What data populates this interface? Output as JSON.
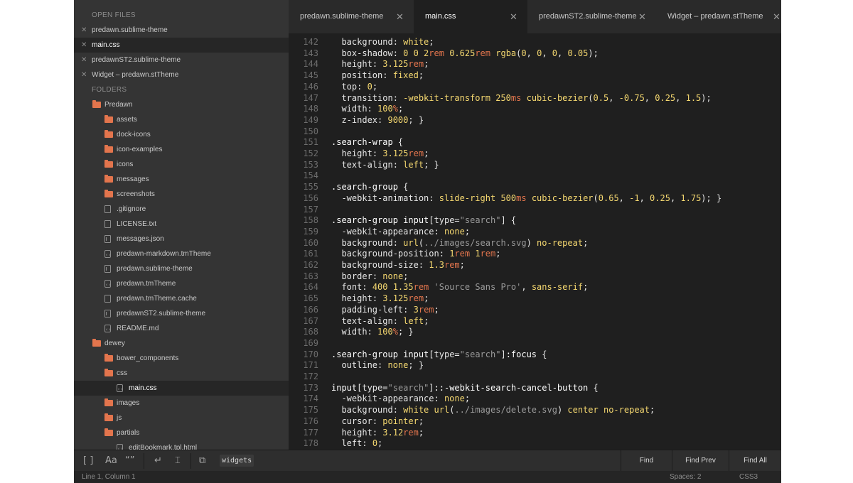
{
  "sidebar": {
    "open_files_title": "OPEN FILES",
    "open_files": [
      {
        "name": "predawn.sublime-theme",
        "active": false
      },
      {
        "name": "main.css",
        "active": true
      },
      {
        "name": "predawnST2.sublime-theme",
        "active": false
      },
      {
        "name": "Widget – predawn.stTheme",
        "active": false
      }
    ],
    "folders_title": "FOLDERS",
    "tree": [
      {
        "name": "Predawn",
        "kind": "folder",
        "depth": 0
      },
      {
        "name": "assets",
        "kind": "folder",
        "depth": 1
      },
      {
        "name": "dock-icons",
        "kind": "folder",
        "depth": 1
      },
      {
        "name": "icon-examples",
        "kind": "folder",
        "depth": 1
      },
      {
        "name": "icons",
        "kind": "folder",
        "depth": 1
      },
      {
        "name": "messages",
        "kind": "folder",
        "depth": 1
      },
      {
        "name": "screenshots",
        "kind": "folder",
        "depth": 1
      },
      {
        "name": ".gitignore",
        "kind": "file",
        "depth": 1
      },
      {
        "name": "LICENSE.txt",
        "kind": "file",
        "depth": 1
      },
      {
        "name": "messages.json",
        "kind": "json",
        "depth": 1
      },
      {
        "name": "predawn-markdown.tmTheme",
        "kind": "code",
        "depth": 1
      },
      {
        "name": "predawn.sublime-theme",
        "kind": "json",
        "depth": 1
      },
      {
        "name": "predawn.tmTheme",
        "kind": "code",
        "depth": 1
      },
      {
        "name": "predawn.tmTheme.cache",
        "kind": "file",
        "depth": 1
      },
      {
        "name": "predawnST2.sublime-theme",
        "kind": "json",
        "depth": 1
      },
      {
        "name": "README.md",
        "kind": "code",
        "depth": 1
      },
      {
        "name": "dewey",
        "kind": "folder",
        "depth": 0
      },
      {
        "name": "bower_components",
        "kind": "folder",
        "depth": 1
      },
      {
        "name": "css",
        "kind": "folder",
        "depth": 1
      },
      {
        "name": "main.css",
        "kind": "code",
        "depth": 2,
        "selected": true
      },
      {
        "name": "images",
        "kind": "folder",
        "depth": 1
      },
      {
        "name": "js",
        "kind": "folder",
        "depth": 1
      },
      {
        "name": "partials",
        "kind": "folder",
        "depth": 1
      },
      {
        "name": "editBookmark.tpl.html",
        "kind": "code",
        "depth": 2
      }
    ]
  },
  "tabs": [
    {
      "label": "predawn.sublime-theme",
      "active": false
    },
    {
      "label": "main.css",
      "active": true
    },
    {
      "label": "predawnST2.sublime-theme",
      "active": false
    },
    {
      "label": "Widget – predawn.stTheme",
      "active": false
    }
  ],
  "editor": {
    "lines": [
      {
        "n": "142",
        "t": "  <span class='t-p'>background</span>: <span class='t-v'>white</span>;"
      },
      {
        "n": "143",
        "t": "  <span class='t-p'>box-shadow</span>: <span class='t-n'>0 0 2</span><span class='t-u'>rem</span> <span class='t-n'>0.625</span><span class='t-u'>rem</span> <span class='t-v'>rgba</span>(<span class='t-n'>0</span>, <span class='t-n'>0</span>, <span class='t-n'>0</span>, <span class='t-n'>0.05</span>);"
      },
      {
        "n": "144",
        "t": "  <span class='t-p'>height</span>: <span class='t-n'>3.125</span><span class='t-u'>rem</span>;"
      },
      {
        "n": "145",
        "t": "  <span class='t-p'>position</span>: <span class='t-v'>fixed</span>;"
      },
      {
        "n": "146",
        "t": "  <span class='t-p'>top</span>: <span class='t-n'>0</span>;"
      },
      {
        "n": "147",
        "t": "  <span class='t-p'>transition</span>: <span class='t-v'>-webkit-transform</span> <span class='t-n'>250</span><span class='t-u'>ms</span> <span class='t-v'>cubic-bezier</span>(<span class='t-n'>0.5</span>, <span class='t-n'>-0.75</span>, <span class='t-n'>0.25</span>, <span class='t-n'>1.5</span>);"
      },
      {
        "n": "148",
        "t": "  <span class='t-p'>width</span>: <span class='t-n'>100</span><span class='t-u'>%</span>;"
      },
      {
        "n": "149",
        "t": "  <span class='t-p'>z-index</span>: <span class='t-n'>9000</span>; }"
      },
      {
        "n": "150",
        "t": ""
      },
      {
        "n": "151",
        "t": "<span class='t-x'>.search-wrap</span> {"
      },
      {
        "n": "152",
        "t": "  <span class='t-p'>height</span>: <span class='t-n'>3.125</span><span class='t-u'>rem</span>;"
      },
      {
        "n": "153",
        "t": "  <span class='t-p'>text-align</span>: <span class='t-v'>left</span>; }"
      },
      {
        "n": "154",
        "t": ""
      },
      {
        "n": "155",
        "t": "<span class='t-x'>.search-group</span> {"
      },
      {
        "n": "156",
        "t": "  <span class='t-p'>-webkit-animation</span>: <span class='t-v'>slide-right</span> <span class='t-n'>500</span><span class='t-u'>ms</span> <span class='t-v'>cubic-bezier</span>(<span class='t-n'>0.65</span>, <span class='t-n'>-1</span>, <span class='t-n'>0.25</span>, <span class='t-n'>1.75</span>); }"
      },
      {
        "n": "157",
        "t": ""
      },
      {
        "n": "158",
        "t": "<span class='t-x'>.search-group input</span>[<span class='t-p'>type</span>=<span class='t-s'>\"search\"</span>] {"
      },
      {
        "n": "159",
        "t": "  <span class='t-p'>-webkit-appearance</span>: <span class='t-v'>none</span>;"
      },
      {
        "n": "160",
        "t": "  <span class='t-p'>background</span>: <span class='t-v'>url</span>(<span class='t-s'>../images/search.svg</span>) <span class='t-v'>no-repeat</span>;"
      },
      {
        "n": "161",
        "t": "  <span class='t-p'>background-position</span>: <span class='t-n'>1</span><span class='t-u'>rem</span> <span class='t-n'>1</span><span class='t-u'>rem</span>;"
      },
      {
        "n": "162",
        "t": "  <span class='t-p'>background-size</span>: <span class='t-n'>1.3</span><span class='t-u'>rem</span>;"
      },
      {
        "n": "163",
        "t": "  <span class='t-p'>border</span>: <span class='t-v'>none</span>;"
      },
      {
        "n": "164",
        "t": "  <span class='t-p'>font</span>: <span class='t-n'>400 1.35</span><span class='t-u'>rem</span> <span class='t-s'>'Source Sans Pro'</span>, <span class='t-v'>sans-serif</span>;"
      },
      {
        "n": "165",
        "t": "  <span class='t-p'>height</span>: <span class='t-n'>3.125</span><span class='t-u'>rem</span>;"
      },
      {
        "n": "166",
        "t": "  <span class='t-p'>padding-left</span>: <span class='t-n'>3</span><span class='t-u'>rem</span>;"
      },
      {
        "n": "167",
        "t": "  <span class='t-p'>text-align</span>: <span class='t-v'>left</span>;"
      },
      {
        "n": "168",
        "t": "  <span class='t-p'>width</span>: <span class='t-n'>100</span><span class='t-u'>%</span>; }"
      },
      {
        "n": "169",
        "t": ""
      },
      {
        "n": "170",
        "t": "<span class='t-x'>.search-group input</span>[<span class='t-p'>type</span>=<span class='t-s'>\"search\"</span>]<span class='t-x'>:focus</span> {"
      },
      {
        "n": "171",
        "t": "  <span class='t-p'>outline</span>: <span class='t-v'>none</span>; }"
      },
      {
        "n": "172",
        "t": ""
      },
      {
        "n": "173",
        "t": "<span class='t-x'>input</span>[<span class='t-p'>type</span>=<span class='t-s'>\"search\"</span>]<span class='t-x'>::-webkit-search-cancel-button</span> {"
      },
      {
        "n": "174",
        "t": "  <span class='t-p'>-webkit-appearance</span>: <span class='t-v'>none</span>;"
      },
      {
        "n": "175",
        "t": "  <span class='t-p'>background</span>: <span class='t-v'>white</span> <span class='t-v'>url</span>(<span class='t-s'>../images/delete.svg</span>) <span class='t-v'>center</span> <span class='t-v'>no-repeat</span>;"
      },
      {
        "n": "176",
        "t": "  <span class='t-p'>cursor</span>: <span class='t-v'>pointer</span>;"
      },
      {
        "n": "177",
        "t": "  <span class='t-p'>height</span>: <span class='t-n'>3.12</span><span class='t-u'>rem</span>;"
      },
      {
        "n": "178",
        "t": "  <span class='t-p'>left</span>: <span class='t-n'>0</span>;"
      }
    ]
  },
  "findbar": {
    "search_value": "widgets",
    "find_label": "Find",
    "find_prev_label": "Find Prev",
    "find_all_label": "Find All"
  },
  "status": {
    "position": "Line 1, Column 1",
    "spaces": "Spaces: 2",
    "syntax": "CSS3"
  }
}
